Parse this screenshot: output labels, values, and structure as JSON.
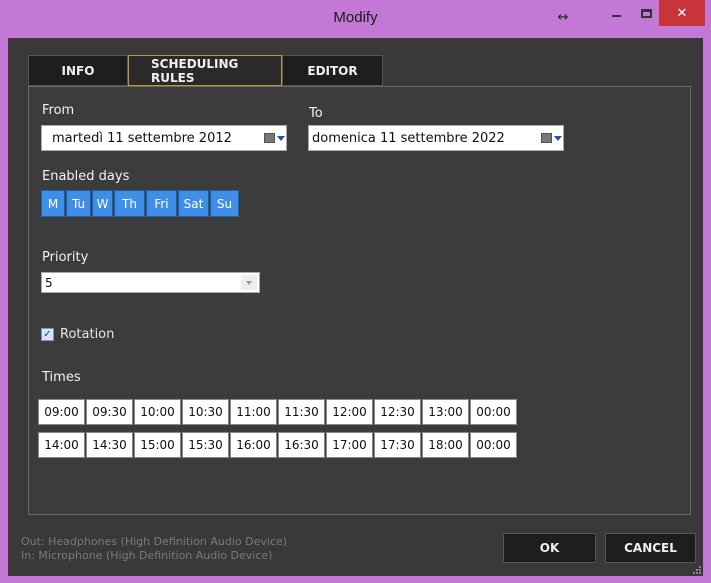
{
  "window": {
    "title": "Modify",
    "resize_glyph": "↔",
    "close_glyph": "✕"
  },
  "tabs": [
    {
      "label": "INFO"
    },
    {
      "label": "SCHEDULING RULES",
      "active": true
    },
    {
      "label": "EDITOR"
    }
  ],
  "form": {
    "from_label": "From",
    "from_value": "martedì   11 settembre 2012",
    "to_label": "To",
    "to_value": "domenica 11 settembre 2022",
    "enabled_days_label": "Enabled days",
    "days": [
      "M",
      "Tu",
      "W",
      "Th",
      "Fri",
      "Sat",
      "Su"
    ],
    "priority_label": "Priority",
    "priority_value": "5",
    "rotation_label": "Rotation",
    "rotation_checked": true,
    "times_label": "Times",
    "times_row1": [
      "09:00",
      "09:30",
      "10:00",
      "10:30",
      "11:00",
      "11:30",
      "12:00",
      "12:30",
      "13:00",
      "00:00"
    ],
    "times_row2": [
      "14:00",
      "14:30",
      "15:00",
      "15:30",
      "16:00",
      "16:30",
      "17:00",
      "17:30",
      "18:00",
      "00:00"
    ]
  },
  "footer": {
    "out_device": "Out: Headphones (High Definition Audio Device)",
    "in_device": "In: Microphone (High Definition Audio Device)",
    "ok_label": "OK",
    "cancel_label": "CANCEL"
  },
  "colors": {
    "accent": "#3f8fe6",
    "window_frame": "#c478d6",
    "background": "#393939",
    "close_button": "#c7343a"
  }
}
